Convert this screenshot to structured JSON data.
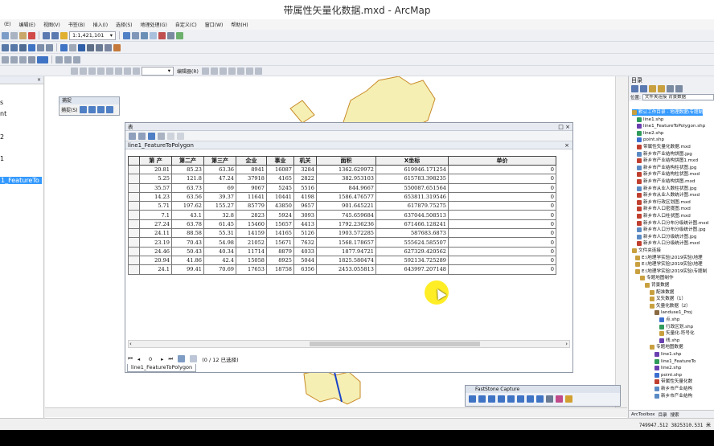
{
  "window": {
    "title": "带属性矢量化数据.mxd - ArcMap"
  },
  "menu": [
    "(E)",
    "编辑(E)",
    "视图(V)",
    "书签(B)",
    "插入(I)",
    "选择(S)",
    "地理处理(G)",
    "自定义(C)",
    "窗口(W)",
    "帮助(H)"
  ],
  "toolbar": {
    "scale": "1:1,421,101",
    "editor_label": "编辑器(R)"
  },
  "left_panel": {
    "close_label": "× ",
    "items": [
      "s",
      "nt",
      "2",
      "1",
      "1_FeatureTo"
    ]
  },
  "float_toolbar": {
    "title": "捕捉",
    "label": "捕捉(S)"
  },
  "table_window": {
    "title": "表",
    "table_name": "line1_FeatureToPolygon",
    "columns": [
      "第 产",
      "第二产",
      "第三产",
      "企业",
      "事业",
      "机关",
      "面积",
      "X坐标",
      "单价"
    ],
    "rows": [
      [
        "20.81",
        "85.23",
        "63.36",
        "8941",
        "16087",
        "3284",
        "1362.629972",
        "619946.171254",
        "0"
      ],
      [
        "5.25",
        "121.8",
        "47.24",
        "37918",
        "4165",
        "2822",
        "382.953103",
        "615783.398235",
        "0"
      ],
      [
        "35.57",
        "63.73",
        "69",
        "9067",
        "5245",
        "5516",
        "844.9667",
        "550087.651564",
        "0"
      ],
      [
        "14.23",
        "63.56",
        "39.37",
        "11641",
        "10441",
        "4198",
        "1586.476577",
        "653811.319546",
        "0"
      ],
      [
        "5.71",
        "197.62",
        "155.27",
        "85779",
        "43850",
        "9657",
        "901.645221",
        "617879.75275",
        "0"
      ],
      [
        "7.1",
        "43.1",
        "32.8",
        "2823",
        "5924",
        "3093",
        "745.659684",
        "637044.508513",
        "0"
      ],
      [
        "27.24",
        "63.78",
        "61.45",
        "15460",
        "15657",
        "4413",
        "1792.236236",
        "671466.128241",
        "0"
      ],
      [
        "24.11",
        "88.58",
        "55.31",
        "14159",
        "14165",
        "5126",
        "1903.572285",
        "587683.6873",
        "0"
      ],
      [
        "23.19",
        "70.43",
        "54.98",
        "21052",
        "15671",
        "7632",
        "1568.178657",
        "555624.585507",
        "0"
      ],
      [
        "24.46",
        "50.43",
        "40.34",
        "11714",
        "8879",
        "4033",
        "1877.94721",
        "627329.420562",
        "0"
      ],
      [
        "20.94",
        "41.86",
        "42.4",
        "15058",
        "8925",
        "5044",
        "1825.580474",
        "592134.725289",
        "0"
      ],
      [
        "24.1",
        "99.41",
        "70.69",
        "17653",
        "18758",
        "6356",
        "2453.055813",
        "643997.207148",
        "0"
      ]
    ],
    "nav_page": "0",
    "record_status": "(0 / 12 已选择)",
    "bottom_tab": "line1_FeatureToPolygon"
  },
  "catalog": {
    "title": "目录",
    "location_label": "位置:",
    "location_value": "文件夹连接  背景数据",
    "items": [
      "默认工作目录 - 地理数据\\专题制",
      "line1.shp",
      "line1_FeatureToPolygon.shp",
      "line2.shp",
      "point.shp",
      "带属性矢量化数据.mxd",
      "新乡市产业结构饼图.jpg",
      "新乡市产业结构饼图1.mxd",
      "新乡市产业结构柱状图.jpg",
      "新乡市产业结构柱状图.mxd",
      "新乡市产业结构饼图.mxd",
      "新乡市从业人数柱状图.jpg",
      "新乡市从业人数统计图.mxd",
      "新乡市行政区划图.mxd",
      "新乡市人口密度图.mxd",
      "新乡市人口柱状图.mxd",
      "新乡市人口分布分级统计图.mxd",
      "新乡市人口分布分级统计图.jpg",
      "新乡市人口分级统计图.jpg",
      "新乡市人口分级统计图.mxd",
      "文件夹连接",
      "E:\\地理学实验\\2019实验\\地理",
      "E:\\地理学实验\\2019实验\\地理",
      "E:\\地理学实验\\2019实验\\专题制",
      "专题地图制作",
      "背景数据",
      "配准数据",
      "叉矢数据（1）",
      "矢量化数据（2）",
      "landuse1_Proj",
      "点.shp",
      "行政区划.shp",
      "矢量化-符号化",
      "线.shp",
      "专题地图数据",
      "line1.shp",
      "line1_FeatureTo",
      "line2.shp",
      "point.shp",
      "带属性矢量化数",
      "新乡市产业结构",
      "新乡市产业结构"
    ],
    "bottom_tabs": [
      "ArcToolbox",
      "目录",
      "搜索"
    ]
  },
  "fastone": {
    "title": "FastStone Capture"
  },
  "status": {
    "coords": "749947.512  3825310.531 米"
  },
  "colors": {
    "selection": "#3399ff",
    "map_fill": "#f5efb3",
    "map_border": "#c98a28",
    "river": "#1a44c8",
    "cursor_highlight": "#ffeb00"
  }
}
